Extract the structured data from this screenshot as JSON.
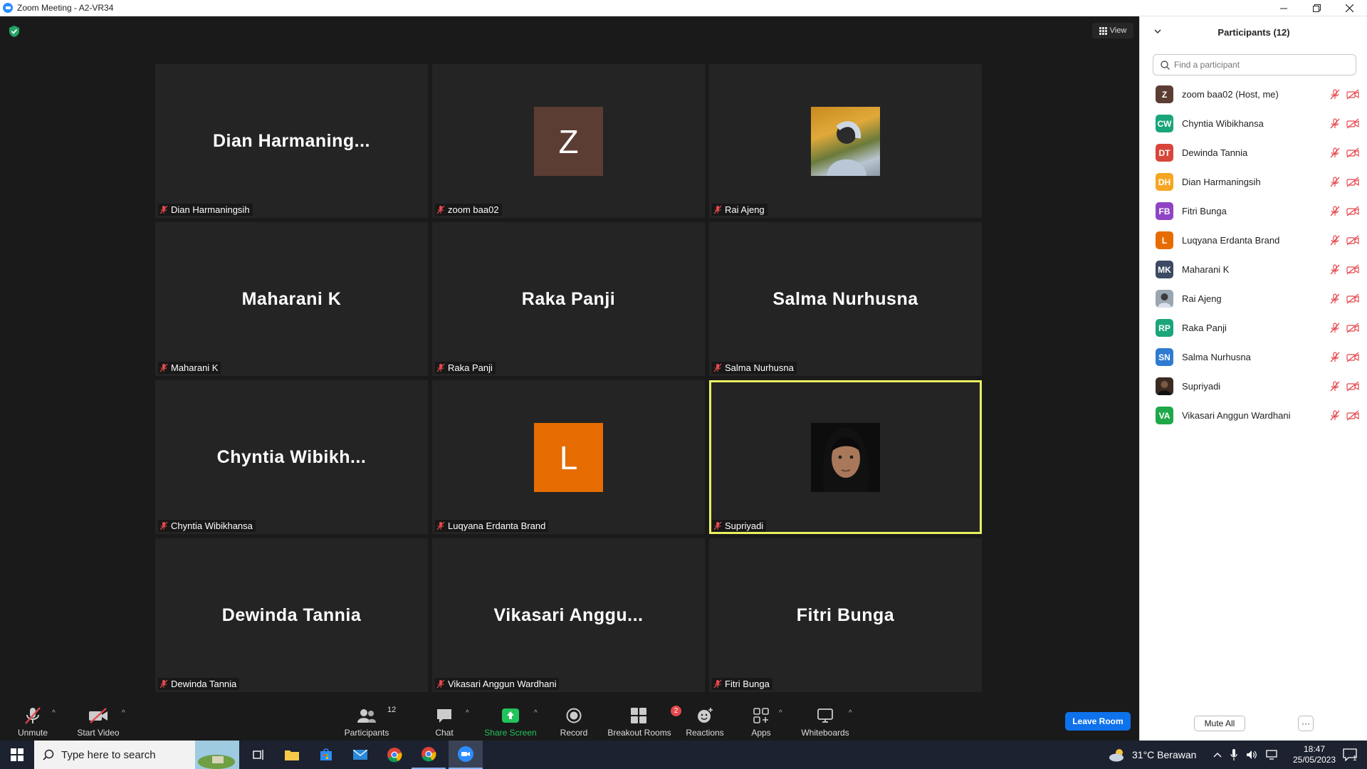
{
  "window": {
    "title": "Zoom Meeting - A2-VR34"
  },
  "meeting": {
    "view_label": "View",
    "tiles": [
      {
        "display": "Dian  Harmaning...",
        "label": "Dian Harmaningsih",
        "type": "name"
      },
      {
        "display": "Z",
        "label": "zoom baa02",
        "type": "letter",
        "color": "#5c3d33"
      },
      {
        "display": "",
        "label": "Rai Ajeng",
        "type": "photo"
      },
      {
        "display": "Maharani K",
        "label": "Maharani K",
        "type": "name"
      },
      {
        "display": "Raka Panji",
        "label": "Raka Panji",
        "type": "name"
      },
      {
        "display": "Salma Nurhusna",
        "label": "Salma Nurhusna",
        "type": "name"
      },
      {
        "display": "Chyntia  Wibikh...",
        "label": "Chyntia Wibikhansa",
        "type": "name"
      },
      {
        "display": "L",
        "label": "Luqyana Erdanta Brand",
        "type": "letter",
        "color": "#e66c02"
      },
      {
        "display": "",
        "label": "Supriyadi",
        "type": "face",
        "active": true
      },
      {
        "display": "Dewinda Tannia",
        "label": "Dewinda Tannia",
        "type": "name"
      },
      {
        "display": "Vikasari  Anggu...",
        "label": "Vikasari Anggun Wardhani",
        "type": "name"
      },
      {
        "display": "Fitri Bunga",
        "label": "Fitri Bunga",
        "type": "name"
      }
    ]
  },
  "toolbar": {
    "unmute": "Unmute",
    "start_video": "Start Video",
    "participants": "Participants",
    "participants_count": "12",
    "chat": "Chat",
    "share_screen": "Share Screen",
    "record": "Record",
    "breakout_rooms": "Breakout Rooms",
    "breakout_badge": "2",
    "reactions": "Reactions",
    "apps": "Apps",
    "whiteboards": "Whiteboards",
    "leave": "Leave Room"
  },
  "panel": {
    "title": "Participants (12)",
    "search_placeholder": "Find a participant",
    "participants": [
      {
        "initials": "Z",
        "name": "zoom baa02 (Host, me)",
        "color": "#5c3d33"
      },
      {
        "initials": "CW",
        "name": "Chyntia Wibikhansa",
        "color": "#1aa57a"
      },
      {
        "initials": "DT",
        "name": "Dewinda Tannia",
        "color": "#d8453a"
      },
      {
        "initials": "DH",
        "name": "Dian Harmaningsih",
        "color": "#f5a623"
      },
      {
        "initials": "FB",
        "name": "Fitri Bunga",
        "color": "#8e44c4"
      },
      {
        "initials": "L",
        "name": "Luqyana Erdanta Brand",
        "color": "#e66c02"
      },
      {
        "initials": "MK",
        "name": "Maharani K",
        "color": "#3c4a63"
      },
      {
        "initials": "",
        "name": "Rai Ajeng",
        "color": "#9aa6b2",
        "photo": true
      },
      {
        "initials": "RP",
        "name": "Raka Panji",
        "color": "#1aa57a"
      },
      {
        "initials": "SN",
        "name": "Salma Nurhusna",
        "color": "#2e7bd1"
      },
      {
        "initials": "",
        "name": "Supriyadi",
        "color": "#3a2a22",
        "photo": true
      },
      {
        "initials": "VA",
        "name": "Vikasari Anggun Wardhani",
        "color": "#1ea84a"
      }
    ],
    "mute_all": "Mute All",
    "more": "···"
  },
  "taskbar": {
    "search_placeholder": "Type here to search",
    "weather": "31°C  Berawan",
    "time": "18:47",
    "date": "25/05/2023",
    "notif_count": "1"
  }
}
